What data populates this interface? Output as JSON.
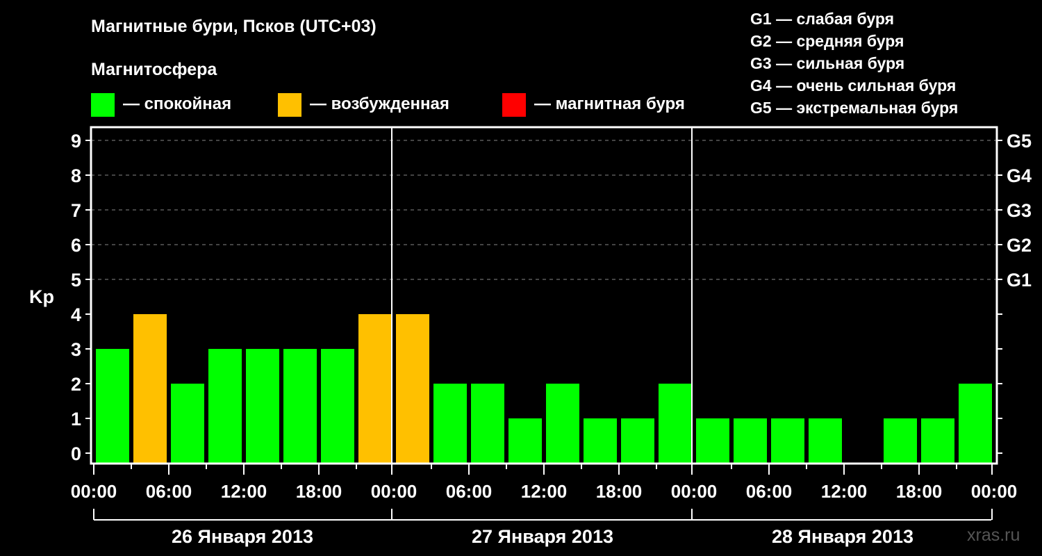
{
  "chart_data": {
    "type": "bar",
    "title": "Магнитные бури, Псков (UTC+03)",
    "legend_title": "Магнитосфера",
    "legend": [
      {
        "label": "— спокойная",
        "color": "#00ff00"
      },
      {
        "label": "— возбужденная",
        "color": "#ffc000"
      },
      {
        "label": "— магнитная буря",
        "color": "#ff0000"
      }
    ],
    "storm_scale": [
      "G1 — слабая буря",
      "G2 — средняя буря",
      "G3 — сильная буря",
      "G4 — очень сильная буря",
      "G5 — экстремальная буря"
    ],
    "ylabel": "Kp",
    "ylim": [
      0,
      9
    ],
    "yticks": [
      "0",
      "1",
      "2",
      "3",
      "4",
      "5",
      "6",
      "7",
      "8",
      "9"
    ],
    "right_ticks": [
      {
        "value": 5,
        "label": "G1"
      },
      {
        "value": 6,
        "label": "G2"
      },
      {
        "value": 7,
        "label": "G3"
      },
      {
        "value": 8,
        "label": "G4"
      },
      {
        "value": 9,
        "label": "G5"
      }
    ],
    "xticks": [
      "00:00",
      "06:00",
      "12:00",
      "18:00",
      "00:00",
      "06:00",
      "12:00",
      "18:00",
      "00:00",
      "06:00",
      "12:00",
      "18:00",
      "00:00"
    ],
    "days": [
      "26 Января 2013",
      "27 Января 2013",
      "28 Января 2013"
    ],
    "interval_hours": 3,
    "values": [
      3,
      4,
      2,
      3,
      3,
      3,
      3,
      4,
      4,
      2,
      2,
      1,
      2,
      1,
      1,
      2,
      1,
      1,
      1,
      1,
      null,
      1,
      1,
      2
    ],
    "grid": true
  },
  "watermark": "xras.ru"
}
